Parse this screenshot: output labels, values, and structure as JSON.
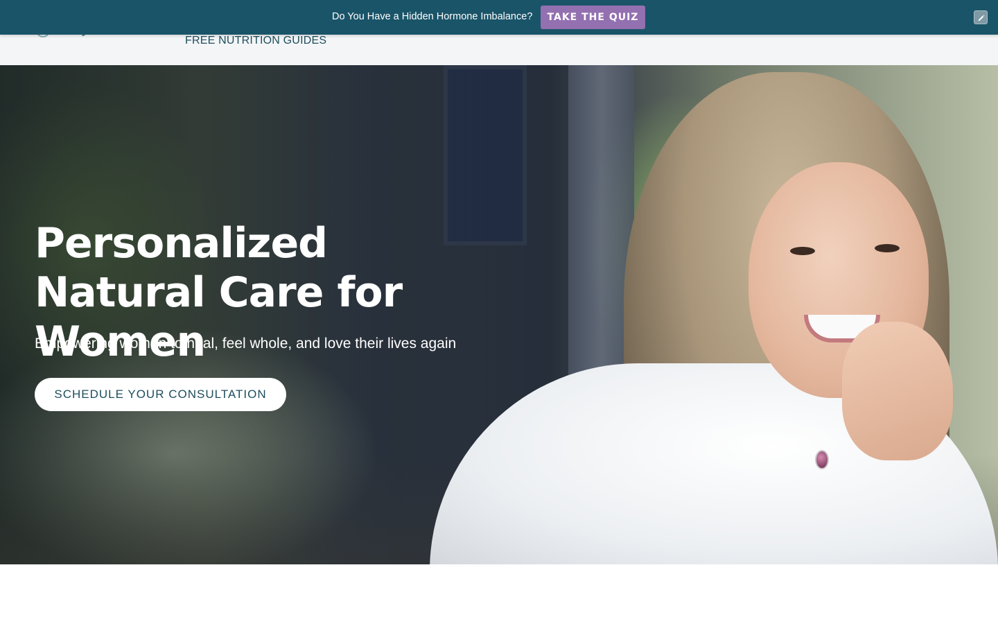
{
  "header": {
    "logo_text": "DR. JILLIAN PINKER",
    "nav_link": "FREE NUTRITION GUIDES"
  },
  "promo_bar": {
    "text": "Do You Have a Hidden Hormone Imbalance?",
    "cta_label": "TAKE THE QUIZ",
    "edit_icon": "pencil-icon"
  },
  "hero": {
    "title": "Personalized Natural Care for Women",
    "subtitle": "Empowering women to heal, feel whole, and love their lives again",
    "cta_label": "SCHEDULE YOUR CONSULTATION"
  },
  "colors": {
    "promo_bg": "#1a5468",
    "quiz_button": "#9370b0",
    "brand_teal": "#1d4d5c"
  }
}
